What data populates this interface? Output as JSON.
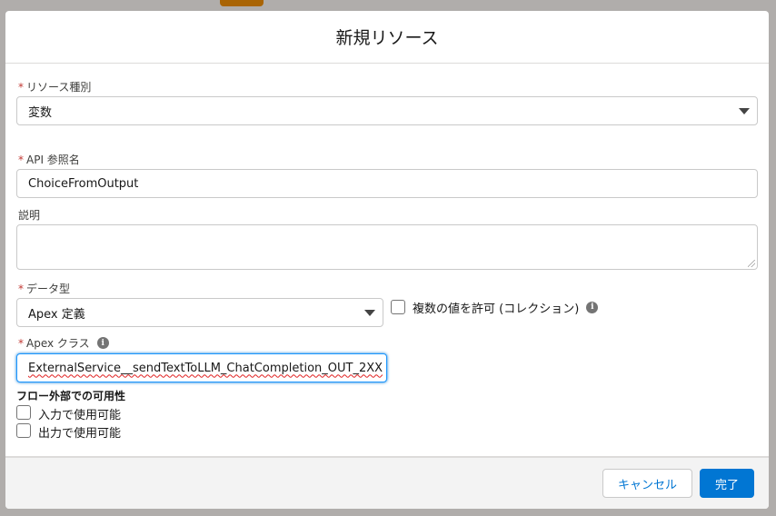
{
  "modal": {
    "title": "新規リソース"
  },
  "resource_type": {
    "label": "リソース種別",
    "value": "変数"
  },
  "api_name": {
    "label": "API 参照名",
    "value": "ChoiceFromOutput"
  },
  "description": {
    "label": "説明",
    "value": ""
  },
  "data_type": {
    "label": "データ型",
    "value": "Apex 定義",
    "allow_multiple_label": "複数の値を許可 (コレクション)"
  },
  "apex_class": {
    "label": "Apex クラス",
    "value": "ExternalService__sendTextToLLM_ChatCompletion_OUT_2XX"
  },
  "availability": {
    "title": "フロー外部での可用性",
    "input_label": "入力で使用可能",
    "output_label": "出力で使用可能"
  },
  "footer": {
    "cancel_label": "キャンセル",
    "done_label": "完了"
  },
  "colors": {
    "brand": "#0176d3",
    "required": "#c23934"
  }
}
